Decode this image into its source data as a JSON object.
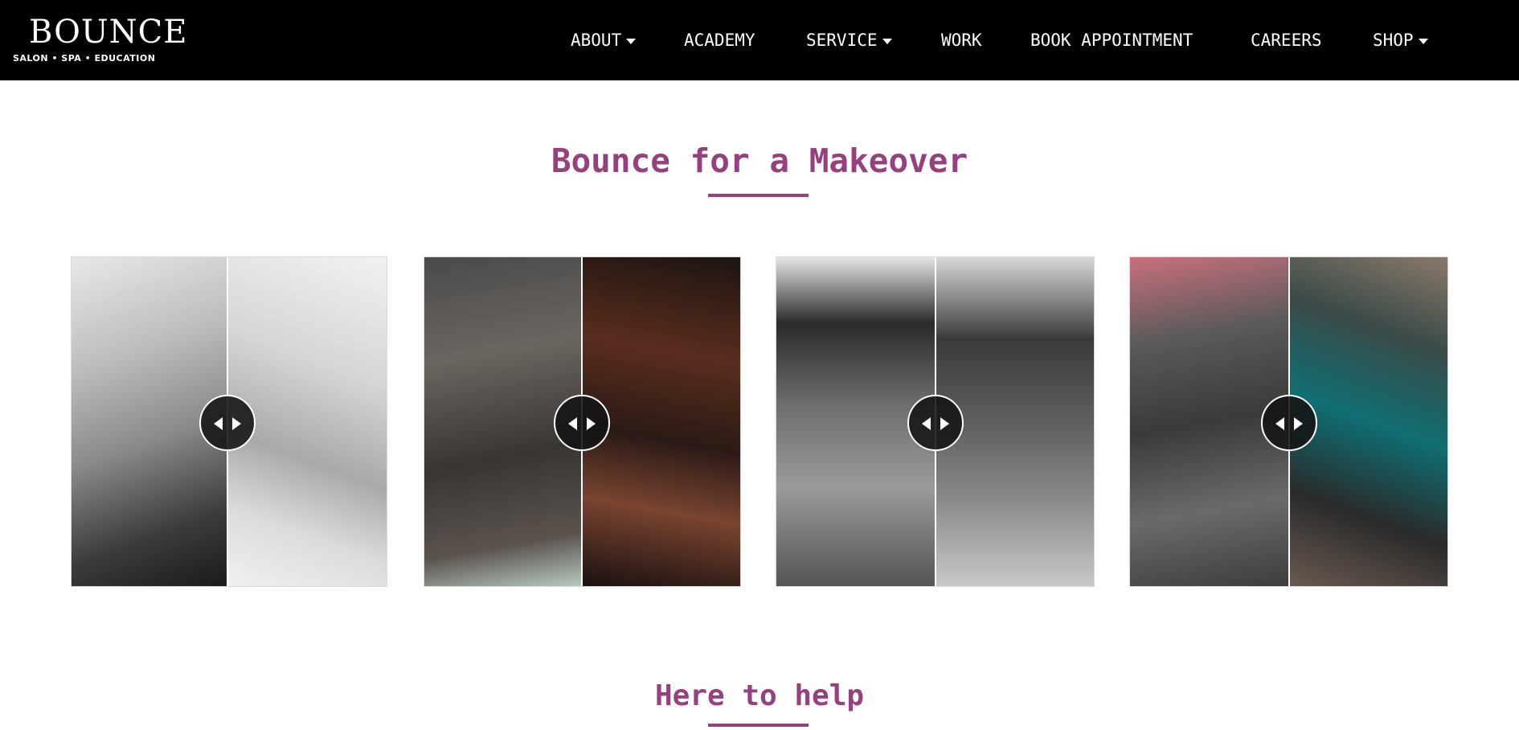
{
  "brand": {
    "name": "Bounce",
    "logo_text": "BOUNCE",
    "tagline": "SALON • SPA • EDUCATION"
  },
  "nav": {
    "items": [
      {
        "label": "ABOUT",
        "has_dropdown": true
      },
      {
        "label": "ACADEMY",
        "has_dropdown": false
      },
      {
        "label": "SERVICE",
        "has_dropdown": true
      },
      {
        "label": "WORK",
        "has_dropdown": false
      },
      {
        "label": "BOOK APPOINTMENT",
        "has_dropdown": false
      },
      {
        "label": "CAREERS",
        "has_dropdown": false
      },
      {
        "label": "SHOP",
        "has_dropdown": true
      }
    ]
  },
  "makeover": {
    "title": "Bounce for a Makeover",
    "sliders": [
      {
        "before": "grayscale-curly-hair",
        "after": "grayscale-undercut",
        "position": 0.5
      },
      {
        "before": "long-wavy-dark-hair",
        "after": "curled-highlighted-hair",
        "position": 0.5
      },
      {
        "before": "boy-side-profile-haircut",
        "after": "spiky-fade-haircut",
        "position": 0.5
      },
      {
        "before": "frizzy-dark-hair",
        "after": "teal-colored-hair",
        "position": 0.5
      }
    ]
  },
  "help": {
    "title": "Here to help"
  },
  "colors": {
    "accent": "#97407f",
    "header_bg": "#000000",
    "text_on_dark": "#ffffff"
  },
  "icons": {
    "dropdown": "caret-down-icon",
    "slider_handle": "left-right-arrows-icon"
  }
}
